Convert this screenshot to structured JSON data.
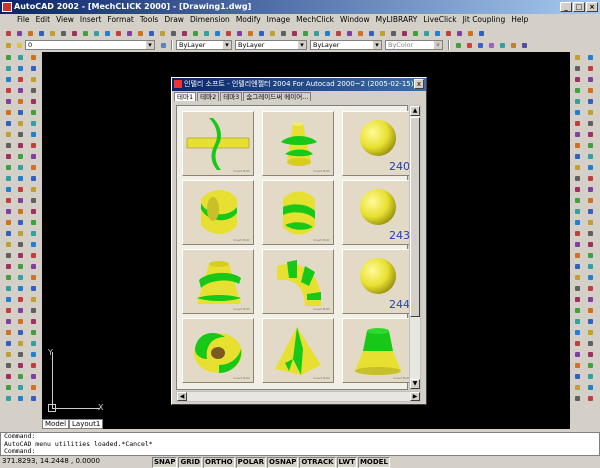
{
  "window": {
    "title": "AutoCAD 2002 - [MechCLICK 2000] - [Drawing1.dwg]"
  },
  "menu": [
    "File",
    "Edit",
    "View",
    "Insert",
    "Format",
    "Tools",
    "Draw",
    "Dimension",
    "Modify",
    "Image",
    "MechClick",
    "Window",
    "MyLIBRARY",
    "LiveClick",
    "Jit Coupling",
    "Help"
  ],
  "layer_combo": "0",
  "props": {
    "color": "ByLayer",
    "linetype": "ByLayer",
    "lineweight": "ByLayer",
    "plotstyle": "ByColor"
  },
  "dialog": {
    "title": "인텔리 소프트 - 인텔리엔젤터 2004 For Autocad 2000~2 (2005-02-15)",
    "close": "x",
    "tabs": [
      "테마1",
      "테마2",
      "테마3",
      "숨그레이드써 메이어..."
    ],
    "numbers": {
      "r1": "240",
      "r2": "243",
      "r3": "244"
    },
    "watermark": "Insert Both"
  },
  "ucs": {
    "x": "X",
    "y": "Y"
  },
  "layout_tabs": [
    "Model",
    "Layout1"
  ],
  "command_lines": [
    "Command:",
    "AutoCAD menu utilities loaded.*Cancel*",
    "Command:"
  ],
  "status": {
    "coords": "371.8293, 14.2448 , 0.0000",
    "buttons": [
      "SNAP",
      "GRID",
      "ORTHO",
      "POLAR",
      "OSNAP",
      "OTRACK",
      "LWT",
      "MODEL"
    ]
  },
  "colors": {
    "shape_yellow": "#e8e030",
    "shape_green": "#18c818",
    "accent_blue": "#2040c0",
    "canvas": "#000000"
  }
}
